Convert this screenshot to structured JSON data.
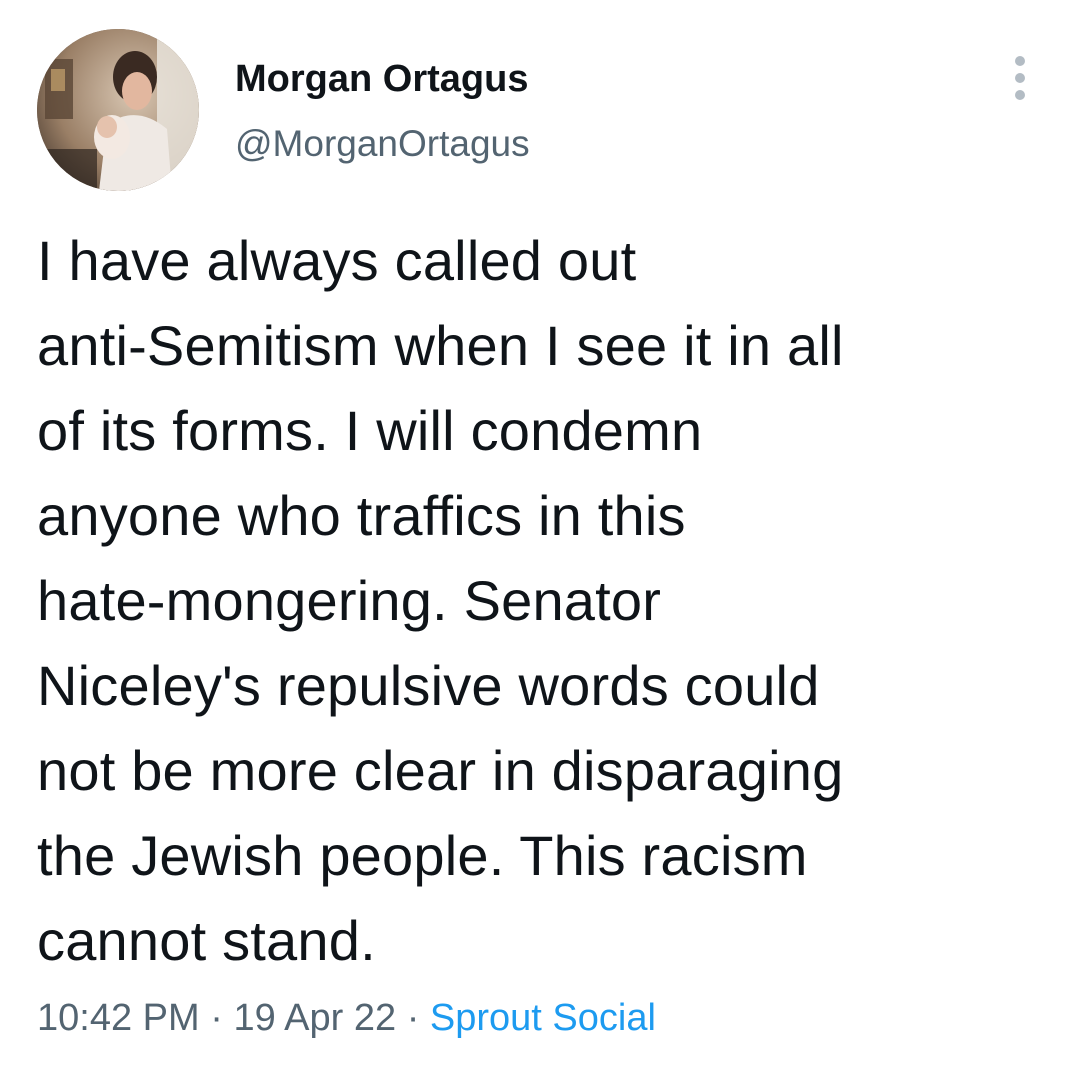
{
  "author": {
    "display_name": "Morgan Ortagus",
    "handle": "@MorganOrtagus",
    "avatar_icon": "profile-photo"
  },
  "menu": {
    "icon": "more-vertical-icon"
  },
  "tweet": {
    "lines": [
      "I have always called out",
      "anti-Semitism when I see it in all",
      "of its forms. I will condemn",
      "anyone who traffics in this",
      "hate-mongering. Senator",
      "Niceley's repulsive words could",
      "not be more clear in disparaging",
      "the Jewish people. This racism",
      "cannot stand."
    ]
  },
  "meta": {
    "time": "10:42 PM",
    "separator": "·",
    "date": "19 Apr 22",
    "source": "Sprout Social"
  },
  "colors": {
    "text": "#0f1419",
    "secondary": "#536471",
    "link": "#1d9bf0"
  }
}
